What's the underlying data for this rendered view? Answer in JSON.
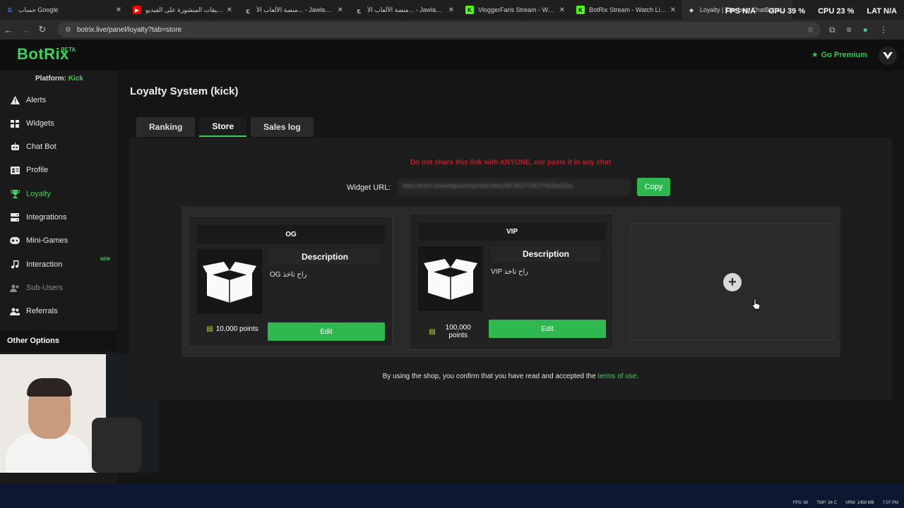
{
  "browser": {
    "tabs": [
      {
        "label": "حساب Google",
        "fav": "G",
        "fav_color": "#ffffff",
        "fav_text_color": "#4285f4"
      },
      {
        "label": "التعليقات المنشورة على الفيديو",
        "fav": "▶",
        "fav_color": "#ff0000",
        "fav_text_color": "#ffffff"
      },
      {
        "label": "منصة الألعاب الأ... - Jawlah | جولة",
        "fav": "ج",
        "fav_color": "#1f1f1f",
        "fav_text_color": "#ffffff"
      },
      {
        "label": "منصة الألعاب الأ... - Jawlah | جولة",
        "fav": "ج",
        "fav_color": "#1f1f1f",
        "fav_text_color": "#ffffff"
      },
      {
        "label": "VloggerFaris Stream - Watch Li...",
        "fav": "K",
        "fav_color": "#53fc18",
        "fav_text_color": "#000000"
      },
      {
        "label": "BotRix Stream - Watch Live on...",
        "fav": "K",
        "fav_color": "#53fc18",
        "fav_text_color": "#000000"
      },
      {
        "label": "Loyalty | The best ChatBot and...",
        "fav": "◆",
        "fav_color": "#1f1f1f",
        "fav_text_color": "#ffffff"
      }
    ],
    "url": "botrix.live/panel/loyalty?tab=store",
    "stats": {
      "fps": "FPS N/A",
      "gpu": "GPU 39 %",
      "cpu": "CPU 23 %",
      "lat": "LAT N/A"
    }
  },
  "header": {
    "logo": "BotRix",
    "beta": "BETA",
    "premium": "Go Premium"
  },
  "sidebar": {
    "platform_label": "Platform:",
    "platform_value": "Kick",
    "items": [
      {
        "label": "Alerts",
        "icon": "warning-icon"
      },
      {
        "label": "Widgets",
        "icon": "grid-icon"
      },
      {
        "label": "Chat Bot",
        "icon": "robot-icon"
      },
      {
        "label": "Profile",
        "icon": "id-card-icon"
      },
      {
        "label": "Loyalty",
        "icon": "trophy-icon"
      },
      {
        "label": "Integrations",
        "icon": "server-icon"
      },
      {
        "label": "Mini-Games",
        "icon": "gamepad-icon"
      },
      {
        "label": "Interaction",
        "icon": "music-icon",
        "badge": "NEW"
      },
      {
        "label": "Sub-Users",
        "icon": "users-icon"
      },
      {
        "label": "Referrals",
        "icon": "user-group-icon"
      }
    ],
    "other_options": "Other Options"
  },
  "main": {
    "title": "Loyalty System (kick)",
    "tabs": [
      "Ranking",
      "Store",
      "Sales log"
    ],
    "active_tab": "Store",
    "warning": "Do not share this link with ANYONE, nor paste it in any chat",
    "widget_url_label": "Widget URL:",
    "widget_url_value": "https://botrix.live/widgets/shop?bid=Wkq7BXJBCFYdE7F9xZbe0Zzq",
    "copy_label": "Copy",
    "items": [
      {
        "title": "OG",
        "description_header": "Description",
        "description": "راح تاخذ OG",
        "points": "10,000 points",
        "edit": "Edit"
      },
      {
        "title": "VIP",
        "description_header": "Description",
        "description": "راح تاخذ VIP",
        "points": "100,000 points",
        "edit": "Edit"
      }
    ],
    "terms_before": "By using the shop, you confirm that you have read and accepted the",
    "terms_link": "terms of use",
    "terms_after": "."
  },
  "taskbar": {
    "fps": "FPS: 60",
    "tmp": "TMP: 34 C",
    "vram": "VRM: 1458 MB",
    "time": "7:07 PM"
  },
  "colors": {
    "accent": "#3fcf5c",
    "warning": "#b3202f",
    "button": "#2fb84f"
  }
}
